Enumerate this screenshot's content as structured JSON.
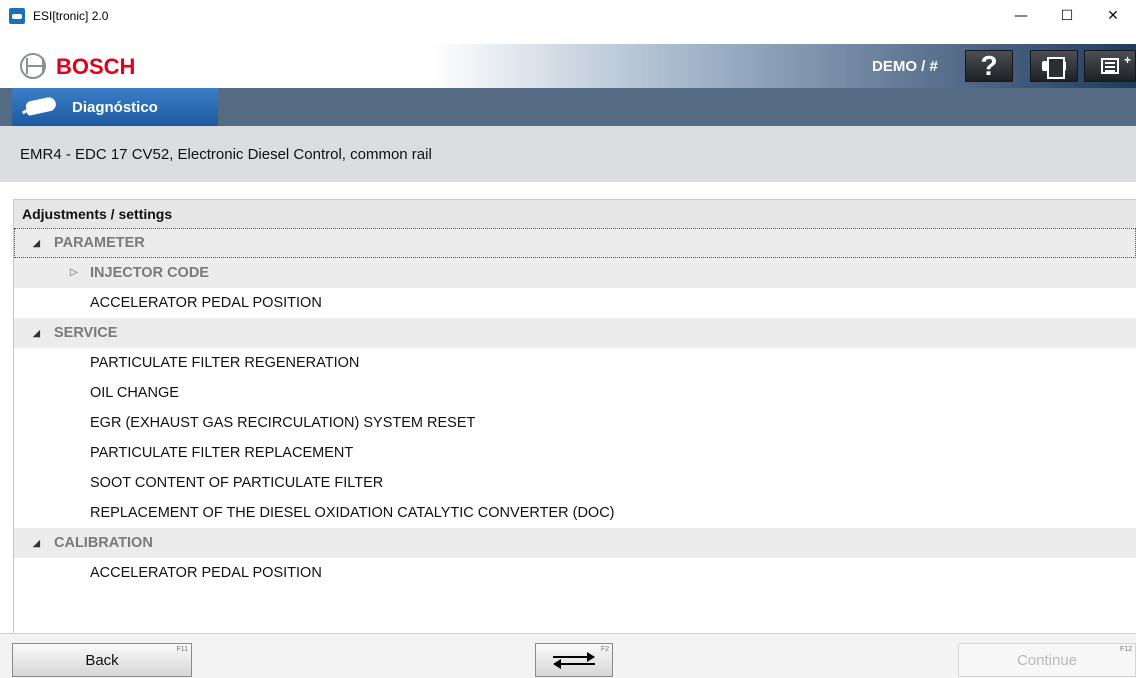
{
  "window": {
    "title": "ESI[tronic] 2.0",
    "minimize_glyph": "—",
    "maximize_glyph": "☐",
    "close_glyph": "✕"
  },
  "header": {
    "brand": "BOSCH",
    "user_label": "DEMO / #",
    "help_glyph": "?",
    "brand_color": "#e2001a"
  },
  "tab": {
    "label": "Diagnóstico"
  },
  "subheader": {
    "title": "EMR4 - EDC 17 CV52, Electronic Diesel Control, common rail"
  },
  "tree": {
    "header": "Adjustments / settings",
    "groups": [
      {
        "label": "PARAMETER",
        "items": [
          {
            "label": "INJECTOR CODE",
            "expandable": true
          },
          {
            "label": "ACCELERATOR PEDAL POSITION"
          }
        ]
      },
      {
        "label": "SERVICE",
        "items": [
          {
            "label": "PARTICULATE FILTER REGENERATION"
          },
          {
            "label": "OIL CHANGE"
          },
          {
            "label": "EGR (EXHAUST GAS RECIRCULATION) SYSTEM RESET"
          },
          {
            "label": "PARTICULATE FILTER REPLACEMENT"
          },
          {
            "label": "SOOT CONTENT OF PARTICULATE FILTER"
          },
          {
            "label": "REPLACEMENT OF THE DIESEL OXIDATION CATALYTIC CONVERTER (DOC)"
          }
        ]
      },
      {
        "label": "CALIBRATION",
        "items": [
          {
            "label": "ACCELERATOR PEDAL POSITION"
          }
        ]
      }
    ]
  },
  "footer": {
    "back_label": "Back",
    "back_key": "F11",
    "swap_key": "F2",
    "continue_label": "Continue",
    "continue_key": "F12"
  }
}
